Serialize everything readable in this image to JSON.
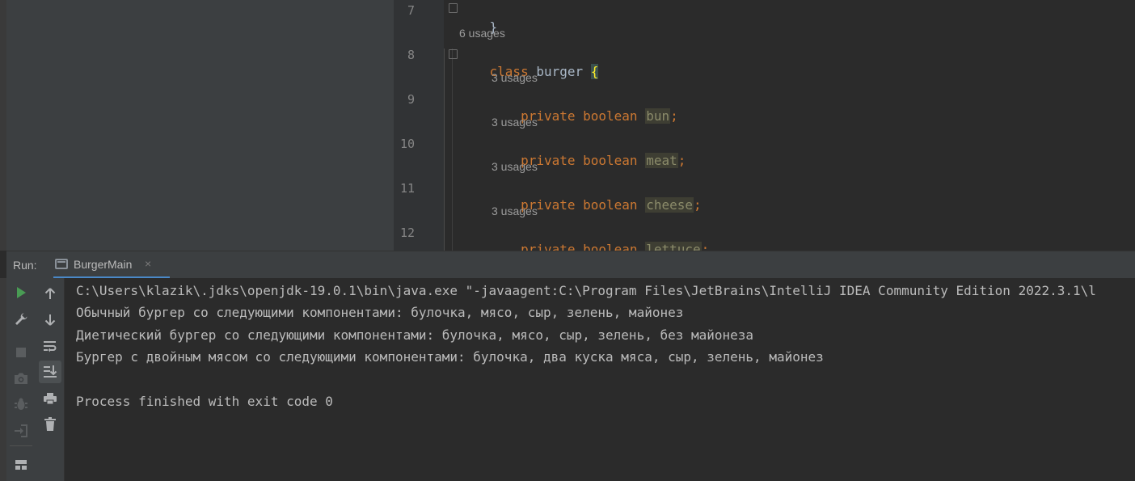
{
  "editor": {
    "lines": [
      {
        "number": "7",
        "usages": "",
        "code": [
          {
            "t": "}",
            "c": "plain"
          }
        ]
      },
      {
        "number": "8",
        "usages": "6 usages",
        "code": [
          {
            "t": "class ",
            "c": "kw"
          },
          {
            "t": "burger ",
            "c": "plain"
          },
          {
            "t": "{",
            "c": "brace-hl"
          }
        ]
      },
      {
        "number": "9",
        "usages": "3 usages",
        "code": [
          {
            "t": "    private boolean ",
            "c": "kw"
          },
          {
            "t": "bun",
            "c": "field"
          },
          {
            "t": ";",
            "c": "kw"
          }
        ]
      },
      {
        "number": "10",
        "usages": "3 usages",
        "code": [
          {
            "t": "    private boolean ",
            "c": "kw"
          },
          {
            "t": "meat",
            "c": "field"
          },
          {
            "t": ";",
            "c": "kw"
          }
        ]
      },
      {
        "number": "11",
        "usages": "3 usages",
        "code": [
          {
            "t": "    private boolean ",
            "c": "kw"
          },
          {
            "t": "cheese",
            "c": "field"
          },
          {
            "t": ";",
            "c": "kw"
          }
        ]
      },
      {
        "number": "12",
        "usages": "3 usages",
        "code": [
          {
            "t": "    private boolean ",
            "c": "kw"
          },
          {
            "t": "lettuce",
            "c": "field"
          },
          {
            "t": ";",
            "c": "kw"
          }
        ]
      }
    ]
  },
  "run_panel": {
    "label": "Run:",
    "tab_title": "BurgerMain",
    "tab_close": "×"
  },
  "console": {
    "lines": [
      "C:\\Users\\klazik\\.jdks\\openjdk-19.0.1\\bin\\java.exe \"-javaagent:C:\\Program Files\\JetBrains\\IntelliJ IDEA Community Edition 2022.3.1\\l",
      "Обычный бургер со следующими компонентами: булочка, мясо, сыр, зелень, майонез",
      "Диетический бургер со следующими компонентами: булочка, мясо, сыр, зелень, без майонеза",
      "Бургер с двойным мясом со следующими компонентами: булочка, два куска мяса, сыр, зелень, майонез",
      "",
      "Process finished with exit code 0"
    ]
  },
  "icons": {
    "rerun": "play-icon",
    "settings": "wrench-icon",
    "stop": "stop-icon",
    "screenshot": "camera-icon",
    "debug": "bug-icon",
    "exit": "exit-icon",
    "layout": "layout-icon",
    "up": "arrow-up-icon",
    "down": "arrow-down-icon",
    "soft_wrap": "soft-wrap-icon",
    "scroll_to_end": "scroll-to-end-icon",
    "print": "print-icon",
    "clear": "trash-icon"
  },
  "colors": {
    "keyword": "#cc7832",
    "field": "#8b8b6a",
    "brace_highlight": "#ffef28",
    "run_green": "#499c54",
    "tab_underline": "#4a88c7"
  }
}
